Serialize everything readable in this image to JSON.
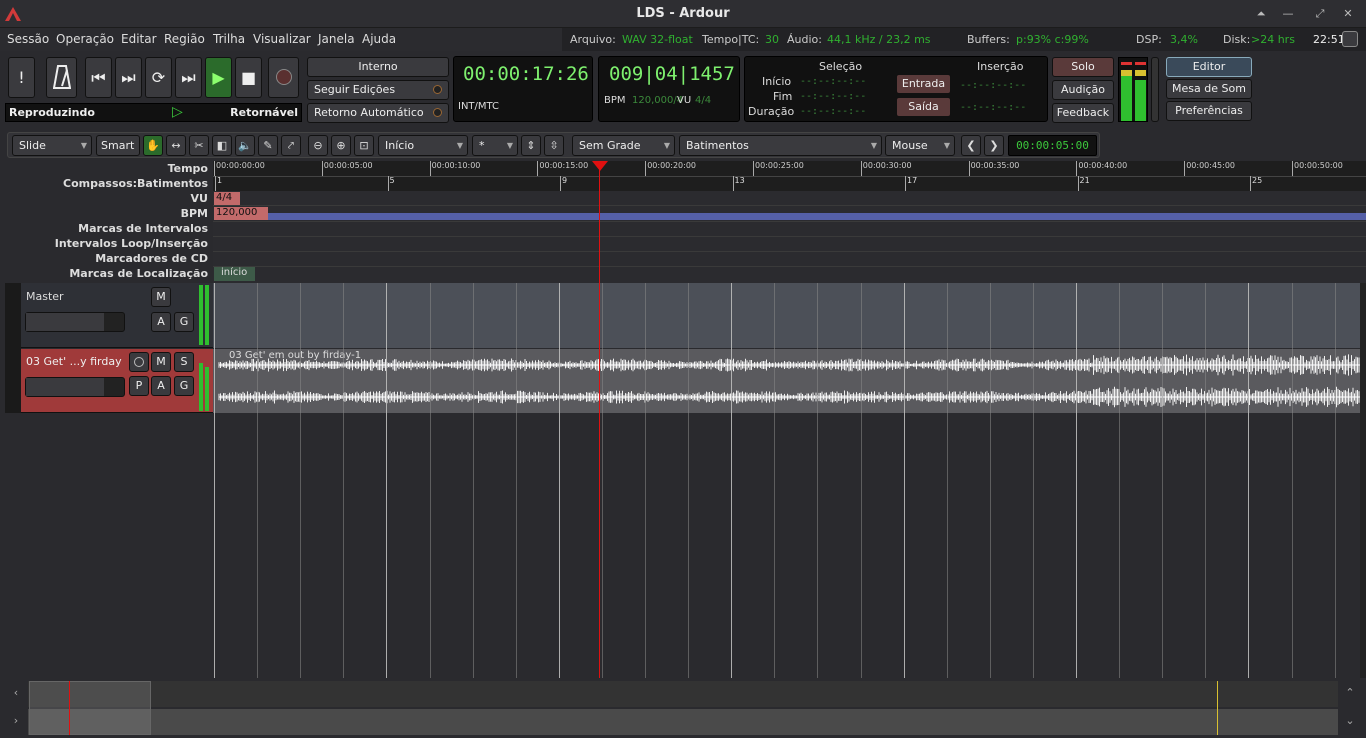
{
  "window": {
    "title": "LDS - Ardour"
  },
  "menu": [
    "Sessão",
    "Operação",
    "Editar",
    "Região",
    "Trilha",
    "Visualizar",
    "Janela",
    "Ajuda"
  ],
  "status": {
    "file_label": "Arquivo:",
    "file_value": "WAV 32-float",
    "tc_label": "Tempo|TC:",
    "tc_value": "30",
    "audio_label": "Áudio:",
    "audio_value": "44,1 kHz / 23,2 ms",
    "buffers_label": "Buffers:",
    "buffers_value": "p:93% c:99%",
    "dsp_label": "DSP:",
    "dsp_value": "3,4%",
    "disk_label": "Disk:",
    "disk_value": ">24 hrs",
    "clock": "22:51"
  },
  "transport": {
    "state_label": "Reproduzindo",
    "returnable_label": "Retornável",
    "internal_btn": "Interno",
    "follow_edits": "Seguir Edições",
    "auto_return": "Retorno Automático",
    "primary_clock": "00:00:17:26",
    "primary_clock_sub": "INT/MTC",
    "secondary_clock": "009|04|1457",
    "bpm_label": "BPM",
    "bpm_value": "120,000/4",
    "vu_label": "VU",
    "vu_value": "4/4",
    "selection_title": "Seleção",
    "insertion_title": "Inserção",
    "sel_start_label": "Início",
    "sel_end_label": "Fim",
    "sel_duration_label": "Duração",
    "empty_tc": "--:--:--:--",
    "entrada_btn": "Entrada",
    "saida_btn": "Saída",
    "solo_btn": "Solo",
    "audition_btn": "Audição",
    "feedback_btn": "Feedback",
    "editor_btn": "Editor",
    "mixer_btn": "Mesa de Som",
    "prefs_btn": "Preferências"
  },
  "edit_toolbar": {
    "mode": "Slide",
    "smart": "Smart",
    "position": "Início",
    "nudge": "*",
    "grid": "Sem Grade",
    "grid_type": "Batimentos",
    "edit_point": "Mouse",
    "nudge_clock": "00:00:05:00"
  },
  "ruler_labels": [
    "Tempo",
    "Compassos:Batimentos",
    "VU",
    "BPM",
    "Marcas de Intervalos",
    "Intervalos Loop/Inserção",
    "Marcadores de CD",
    "Marcas de Localização"
  ],
  "timecode_ticks": [
    "00:00:00:00",
    "00:00:05:00",
    "00:00:10:00",
    "00:00:15:00",
    "00:00:20:00",
    "00:00:25:00",
    "00:00:30:00",
    "00:00:35:00",
    "00:00:40:00",
    "00:00:45:00",
    "00:00:50:00"
  ],
  "bar_ticks": [
    "1",
    "5",
    "9",
    "13",
    "17",
    "21",
    "25"
  ],
  "meter_marker": "4/4",
  "tempo_marker": "120,000",
  "location_marker": "início",
  "tracks": [
    {
      "name": "Master",
      "buttons": [
        "M",
        "A",
        "G"
      ]
    },
    {
      "name": "03 Get' ...y firday",
      "buttons": [
        "M",
        "S",
        "P",
        "A",
        "G"
      ],
      "region": "03 Get' em out by firday-1"
    }
  ],
  "colors": {
    "playhead": "#e01010",
    "track_red": "#a03a3a",
    "bpm_bar": "#5560a8",
    "clock_green": "#7ef06e"
  }
}
